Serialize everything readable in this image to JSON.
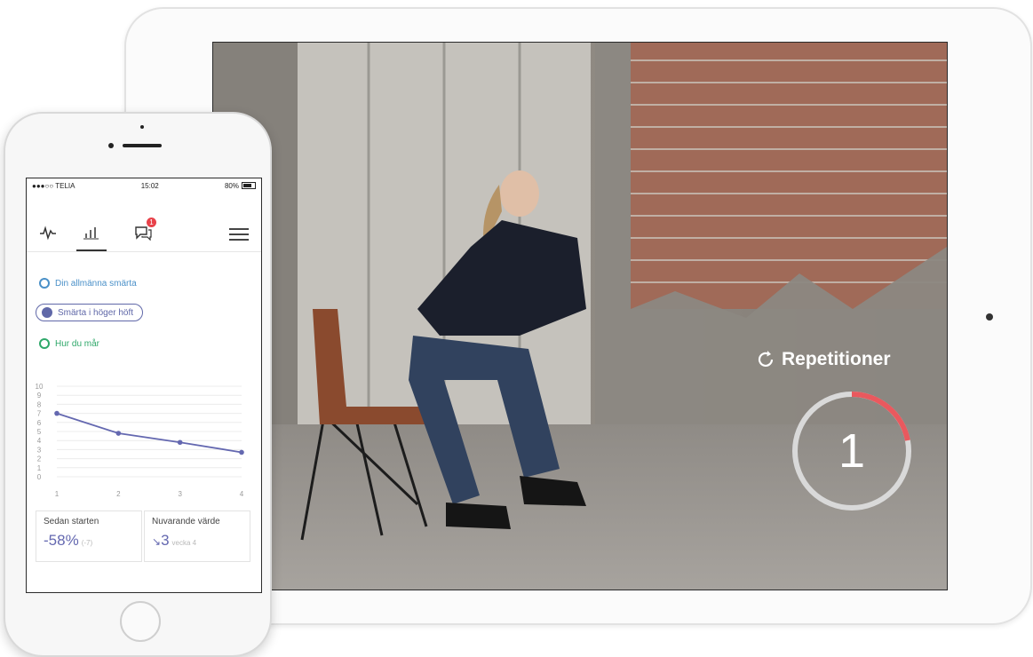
{
  "tablet": {
    "repetitions_label": "Repetitioner",
    "repetition_count": "1",
    "repetition_progress": 0.22,
    "colors": {
      "ring_progress": "#e9595e",
      "ring_track": "#d9d9d9"
    }
  },
  "phone": {
    "status_bar": {
      "carrier": "●●●○○ TELIA",
      "time": "15:02",
      "battery": "80%"
    },
    "nav": {
      "icons": [
        "activity-icon",
        "stats-icon",
        "messages-icon",
        "menu-icon"
      ],
      "notification_count": "1"
    },
    "metrics": [
      {
        "label": "Din allmänna smärta",
        "color": "#4a90c8",
        "selected": false
      },
      {
        "label": "Smärta i höger höft",
        "color": "#6068a8",
        "selected": true
      },
      {
        "label": "Hur du mår",
        "color": "#2fa86a",
        "selected": false
      }
    ],
    "summary": {
      "since_start_label": "Sedan starten",
      "since_start_value": "-58%",
      "since_start_sub": "(-7)",
      "current_label": "Nuvarande värde",
      "current_value": "3",
      "current_sub": "vecka 4"
    }
  },
  "chart_data": {
    "type": "line",
    "x": [
      1,
      2,
      3,
      4
    ],
    "series": [
      {
        "values": [
          7.0,
          4.8,
          3.8,
          2.7
        ]
      }
    ],
    "ylim": [
      0,
      10
    ],
    "yticks": [
      "10",
      "9",
      "8",
      "7",
      "6",
      "5",
      "4",
      "3",
      "2",
      "1",
      "0"
    ],
    "xticks": [
      "1",
      "2",
      "3",
      "4"
    ],
    "grid": true,
    "line_color": "#6468b0"
  }
}
